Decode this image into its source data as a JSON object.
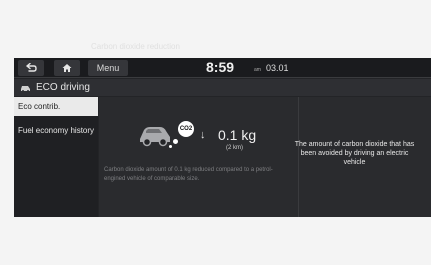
{
  "topbar": {
    "back_icon": "back-arrow-icon",
    "home_icon": "home-icon",
    "menu_label": "Menu",
    "time": "8:59",
    "ampm": "am",
    "date": "03.01"
  },
  "title": {
    "icon": "eco-car-icon",
    "text": "ECO driving"
  },
  "sidebar": {
    "items": [
      {
        "label": "Eco contrib.",
        "active": true
      },
      {
        "label": "Fuel economy history",
        "active": false
      }
    ]
  },
  "main": {
    "section_title": "Carbon dioxide reduction",
    "co2_label": "CO2",
    "arrow_icon": "down-arrow-icon",
    "value": "0.1 kg",
    "distance": "(2 km)",
    "description": "Carbon dioxide amount of 0.1 kg reduced compared to a petrol-engined vehicle of comparable size.",
    "panel_note": "The amount of carbon dioxide that has been avoided by driving an electric vehicle"
  },
  "colors": {
    "background": "#232427",
    "active_item": "#eaeaea",
    "text": "#e6e6e6"
  }
}
